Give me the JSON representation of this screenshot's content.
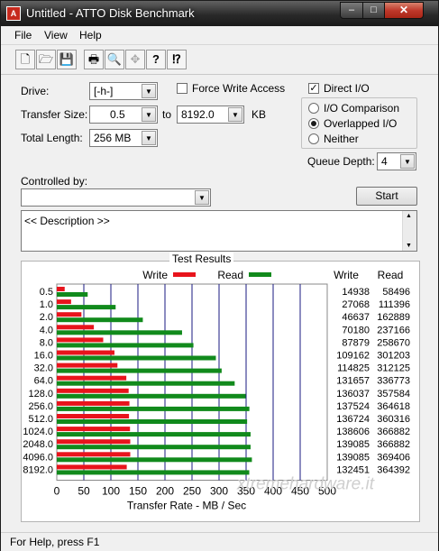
{
  "window": {
    "title": "Untitled - ATTO Disk Benchmark",
    "app_icon_glyph": "A"
  },
  "caption": {
    "minimize": "–",
    "maximize": "□",
    "close": "✕"
  },
  "menu": {
    "file": "File",
    "view": "View",
    "help": "Help"
  },
  "toolbar": {
    "icons": [
      "new-icon",
      "open-icon",
      "save-icon",
      "print-icon",
      "print-preview-icon",
      "move-icon",
      "help-icon",
      "context-help-icon"
    ],
    "glyphs": [
      "🗋",
      "🗁",
      "💾",
      "🖶",
      "🔍",
      "✥",
      "?",
      "⁉"
    ]
  },
  "settings": {
    "drive_label": "Drive:",
    "drive_value": "[-h-]",
    "force_write_label": "Force Write Access",
    "direct_io_label": "Direct I/O",
    "direct_io_checked": true,
    "transfer_size_label": "Transfer Size:",
    "transfer_from": "0.5",
    "to_label": "to",
    "transfer_to": "8192.0",
    "unit_label": "KB",
    "total_length_label": "Total Length:",
    "total_length_value": "256 MB",
    "io_comparison_label": "I/O Comparison",
    "overlapped_io_label": "Overlapped I/O",
    "neither_label": "Neither",
    "queue_depth_label": "Queue Depth:",
    "queue_depth_value": "4",
    "controlled_by_label": "Controlled by:",
    "controlled_by_value": "",
    "start_label": "Start",
    "description_text": "<< Description >>"
  },
  "results": {
    "title": "Test Results",
    "write_legend": "Write",
    "read_legend": "Read",
    "write_col_header": "Write",
    "read_col_header": "Read",
    "xlabel": "Transfer Rate - MB / Sec",
    "watermark": "xtremehardware.it"
  },
  "colors": {
    "write": "#e8141c",
    "read": "#118a1c",
    "grid": "#1a1a80"
  },
  "chart_data": {
    "type": "bar",
    "orientation": "horizontal",
    "title": "Test Results",
    "xlabel": "Transfer Rate - MB / Sec",
    "xlim": [
      0,
      500
    ],
    "xticks": [
      "0",
      "50",
      "100",
      "150",
      "200",
      "250",
      "300",
      "350",
      "400",
      "450",
      "500"
    ],
    "categories": [
      "0.5",
      "1.0",
      "2.0",
      "4.0",
      "8.0",
      "16.0",
      "32.0",
      "64.0",
      "128.0",
      "256.0",
      "512.0",
      "1024.0",
      "2048.0",
      "4096.0",
      "8192.0"
    ],
    "series": [
      {
        "name": "Write",
        "values": [
          14938,
          27068,
          46637,
          70180,
          87879,
          109162,
          114825,
          131657,
          136037,
          137524,
          136724,
          138606,
          139085,
          139085,
          132451
        ]
      },
      {
        "name": "Read",
        "values": [
          58496,
          111396,
          162889,
          237166,
          258670,
          301203,
          312125,
          336773,
          357584,
          364618,
          360316,
          366882,
          366882,
          369406,
          364392
        ]
      }
    ]
  },
  "status": {
    "text": "For Help, press F1"
  }
}
